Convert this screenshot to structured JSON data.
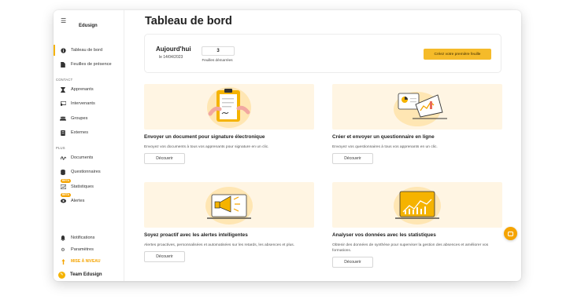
{
  "brand": "Edusign",
  "sidebar": {
    "main_items": [
      {
        "label": "Tableau de bord",
        "icon": "info-icon",
        "active": true
      },
      {
        "label": "Feuilles de présence",
        "icon": "document-icon",
        "active": false
      }
    ],
    "contact_label": "CONTACT",
    "contact_items": [
      {
        "label": "Apprenants",
        "icon": "hourglass-icon"
      },
      {
        "label": "Intervenants",
        "icon": "presenter-icon"
      },
      {
        "label": "Groupes",
        "icon": "group-icon"
      },
      {
        "label": "Externes",
        "icon": "external-icon"
      }
    ],
    "plus_label": "PLUS",
    "plus_items": [
      {
        "label": "Documents",
        "icon": "signature-icon",
        "beta": ""
      },
      {
        "label": "Questionnaires",
        "icon": "database-icon",
        "beta": ""
      },
      {
        "label": "Statistiques",
        "icon": "chart-icon",
        "beta": "BETA"
      },
      {
        "label": "Alertes",
        "icon": "eye-icon",
        "beta": "BETA"
      }
    ],
    "bottom_items": [
      {
        "label": "Notifications",
        "icon": "bell-icon"
      },
      {
        "label": "Paramètres",
        "icon": "gear-icon"
      },
      {
        "label": "MISE À NIVEAU",
        "icon": "upgrade-icon"
      }
    ],
    "team": "Team Edusign"
  },
  "main": {
    "title": "Tableau de bord",
    "today": {
      "title": "Aujourd'hui",
      "date": "le 14/04/2023",
      "stat_value": "3",
      "stat_label": "Feuilles démarrées",
      "create_button": "Créez votre première feuille"
    },
    "features": [
      {
        "title": "Envoyer un document pour signature électronique",
        "description": "Envoyez vos documents à tous vos apprenants pour signature en un clic.",
        "button": "Découvrir"
      },
      {
        "title": "Créer et envoyer un questionnaire en ligne",
        "description": "Envoyez vos questionnaires à tous vos apprenants en un clic.",
        "button": "Découvrir"
      },
      {
        "title": "Soyez proactif avec les alertes intelligentes",
        "description": "Alertes proactives, personnalisées et automatisées sur les retards, les absences et plus.",
        "button": "Découvrir"
      },
      {
        "title": "Analyser vos données avec les statistiques",
        "description": "Obtenir des données de synthèse pour superviser la gestion des absences et améliorer vos formations.",
        "button": "Découvrir"
      }
    ]
  },
  "colors": {
    "accent": "#f5b300",
    "illustration_bg": "#fff5e3"
  }
}
